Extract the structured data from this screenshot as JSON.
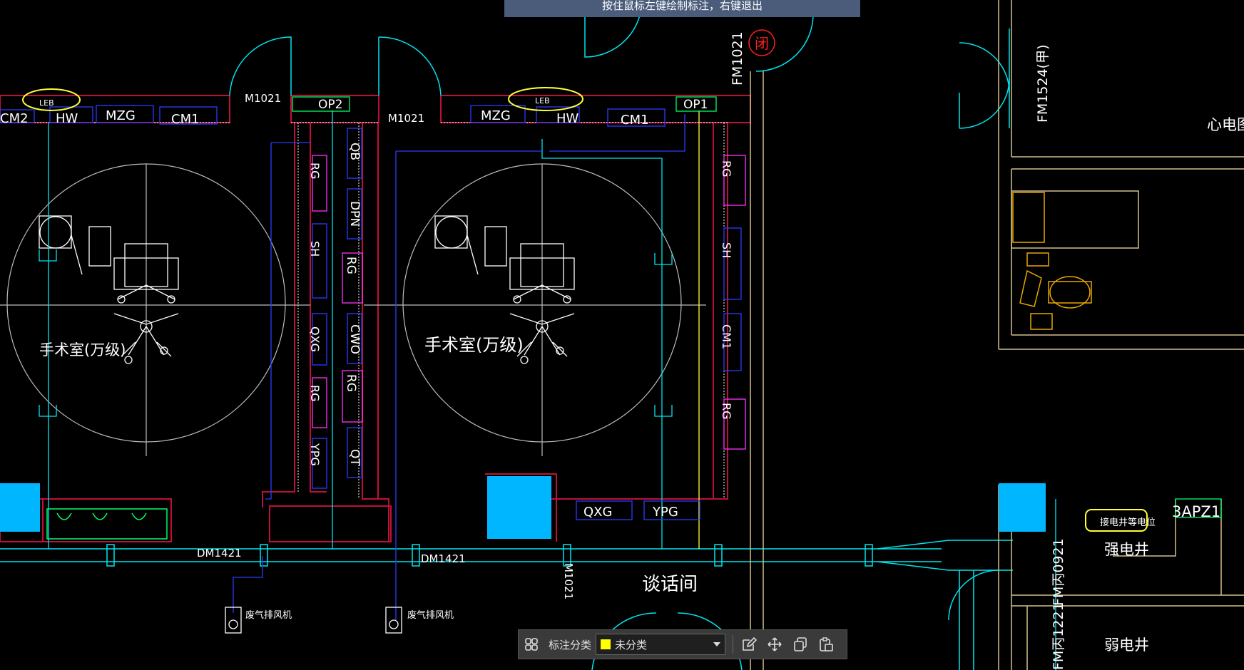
{
  "tooltip": "按住鼠标左键绘制标注，右键退出",
  "drawing": {
    "room_name_left": "手术室(万级)",
    "room_name_right": "手术室(万级)",
    "talk_room": "谈话间",
    "fan_label_1": "废气排风机",
    "fan_label_2": "废气排风机",
    "door_m1021_a": "M1021",
    "door_m1021_b": "M1021",
    "door_m1021_c": "M1021",
    "door_dm1421_a": "DM1421",
    "door_dm1421_b": "DM1421",
    "door_fm1021": "FM1021",
    "door_fm1524": "FM1524(甲)",
    "door_fm0921": "FM丙0921",
    "door_fm1221": "FM丙1221",
    "fire_symbol": "闭",
    "heart_room": "心电图",
    "strong_well": "强电井",
    "weak_well": "弱电井",
    "equip_note": "接电井等电位",
    "apz": "3APZ1",
    "tags": {
      "leb1": "LEB",
      "cm2": "CM2",
      "hw1": "HW",
      "mzg1": "MZG",
      "cm1a": "CM1",
      "op2": "OP2",
      "mzg2": "MZG",
      "leb2": "LEB",
      "hw2": "HW",
      "cm1b": "CM1",
      "op1": "OP1",
      "qb": "QB",
      "dpn": "DPN",
      "rg1": "RG",
      "sh1": "SH",
      "qxg1": "QXG",
      "rg2": "RG",
      "ypg1": "YPG",
      "rg3": "RG",
      "cwo": "CWO",
      "rg4": "RG",
      "qt": "QT",
      "rg5": "RG",
      "sh2": "SH",
      "cm1c": "CM1",
      "rg6": "RG",
      "qxg2": "QXG",
      "ypg2": "YPG"
    }
  },
  "toolbar": {
    "label": "标注分类",
    "selected": "未分类",
    "swatch_color": "#ffff00"
  },
  "colors": {
    "wall_cyan": "#00e5ee",
    "blue_line": "#2a3cff",
    "accent_yellow": "#ffff33",
    "wall_red": "#c0103a"
  }
}
